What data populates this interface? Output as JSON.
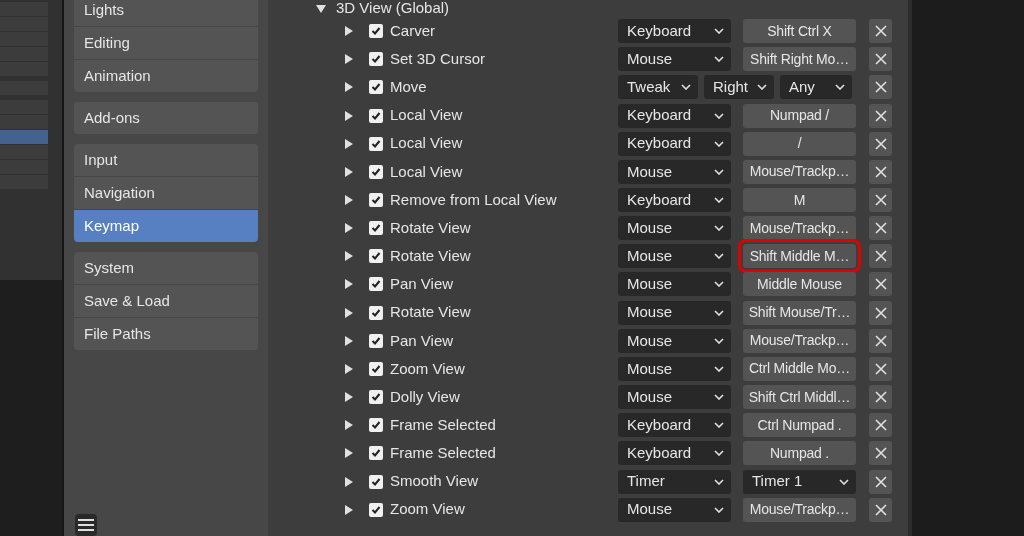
{
  "sidebar": {
    "groups": [
      {
        "items": [
          {
            "label": "Lights",
            "selected": false
          },
          {
            "label": "Editing",
            "selected": false
          },
          {
            "label": "Animation",
            "selected": false
          }
        ]
      },
      {
        "items": [
          {
            "label": "Add-ons",
            "selected": false
          }
        ]
      },
      {
        "items": [
          {
            "label": "Input",
            "selected": false
          },
          {
            "label": "Navigation",
            "selected": false
          },
          {
            "label": "Keymap",
            "selected": true
          }
        ]
      },
      {
        "items": [
          {
            "label": "System",
            "selected": false
          },
          {
            "label": "Save & Load",
            "selected": false
          },
          {
            "label": "File Paths",
            "selected": false
          }
        ]
      }
    ]
  },
  "keymap": {
    "section": {
      "title": "3D View (Global)",
      "expanded": true
    },
    "rows": [
      {
        "name": "Carver",
        "expanded": false,
        "checked": true,
        "inputs": [
          {
            "kind": "dropdown",
            "text": "Keyboard"
          },
          {
            "kind": "key",
            "text": "Shift Ctrl X"
          }
        ]
      },
      {
        "name": "Set 3D Cursor",
        "expanded": false,
        "checked": true,
        "inputs": [
          {
            "kind": "dropdown",
            "text": "Mouse"
          },
          {
            "kind": "key",
            "text": "Shift Right Mo…"
          }
        ]
      },
      {
        "name": "Move",
        "expanded": false,
        "checked": true,
        "inputs": [
          {
            "kind": "small_dropdown",
            "text": "Tweak"
          },
          {
            "kind": "small_dropdown",
            "text": "Right"
          },
          {
            "kind": "small_dropdown",
            "text": "Any"
          }
        ]
      },
      {
        "name": "Local View",
        "expanded": false,
        "checked": true,
        "inputs": [
          {
            "kind": "dropdown",
            "text": "Keyboard"
          },
          {
            "kind": "key",
            "text": "Numpad /"
          }
        ]
      },
      {
        "name": "Local View",
        "expanded": false,
        "checked": true,
        "inputs": [
          {
            "kind": "dropdown",
            "text": "Keyboard"
          },
          {
            "kind": "key",
            "text": "/"
          }
        ]
      },
      {
        "name": "Local View",
        "expanded": false,
        "checked": true,
        "inputs": [
          {
            "kind": "dropdown",
            "text": "Mouse"
          },
          {
            "kind": "key",
            "text": "Mouse/Trackp…"
          }
        ]
      },
      {
        "name": "Remove from Local View",
        "expanded": false,
        "checked": true,
        "inputs": [
          {
            "kind": "dropdown",
            "text": "Keyboard"
          },
          {
            "kind": "key",
            "text": "M"
          }
        ]
      },
      {
        "name": "Rotate View",
        "expanded": false,
        "checked": true,
        "inputs": [
          {
            "kind": "dropdown",
            "text": "Mouse"
          },
          {
            "kind": "key",
            "text": "Mouse/Trackp…"
          }
        ]
      },
      {
        "name": "Rotate View",
        "expanded": false,
        "checked": true,
        "inputs": [
          {
            "kind": "dropdown",
            "text": "Mouse"
          },
          {
            "kind": "key",
            "text": "Shift Middle M…",
            "highlighted": true
          }
        ]
      },
      {
        "name": "Pan View",
        "expanded": false,
        "checked": true,
        "inputs": [
          {
            "kind": "dropdown",
            "text": "Mouse"
          },
          {
            "kind": "key",
            "text": "Middle Mouse"
          }
        ]
      },
      {
        "name": "Rotate View",
        "expanded": false,
        "checked": true,
        "inputs": [
          {
            "kind": "dropdown",
            "text": "Mouse"
          },
          {
            "kind": "key",
            "text": "Shift Mouse/Tr…"
          }
        ]
      },
      {
        "name": "Pan View",
        "expanded": false,
        "checked": true,
        "inputs": [
          {
            "kind": "dropdown",
            "text": "Mouse"
          },
          {
            "kind": "key",
            "text": "Mouse/Trackp…"
          }
        ]
      },
      {
        "name": "Zoom View",
        "expanded": false,
        "checked": true,
        "inputs": [
          {
            "kind": "dropdown",
            "text": "Mouse"
          },
          {
            "kind": "key",
            "text": "Ctrl Middle Mo…"
          }
        ]
      },
      {
        "name": "Dolly View",
        "expanded": false,
        "checked": true,
        "inputs": [
          {
            "kind": "dropdown",
            "text": "Mouse"
          },
          {
            "kind": "key",
            "text": "Shift Ctrl Middl…"
          }
        ]
      },
      {
        "name": "Frame Selected",
        "expanded": false,
        "checked": true,
        "inputs": [
          {
            "kind": "dropdown",
            "text": "Keyboard"
          },
          {
            "kind": "key",
            "text": "Ctrl Numpad ."
          }
        ]
      },
      {
        "name": "Frame Selected",
        "expanded": false,
        "checked": true,
        "inputs": [
          {
            "kind": "dropdown",
            "text": "Keyboard"
          },
          {
            "kind": "key",
            "text": "Numpad ."
          }
        ]
      },
      {
        "name": "Smooth View",
        "expanded": false,
        "checked": true,
        "inputs": [
          {
            "kind": "dropdown",
            "text": "Timer"
          },
          {
            "kind": "dropdown",
            "text": "Timer 1"
          }
        ]
      },
      {
        "name": "Zoom View",
        "expanded": false,
        "checked": true,
        "inputs": [
          {
            "kind": "dropdown",
            "text": "Mouse"
          },
          {
            "kind": "key",
            "text": "Mouse/Trackp…"
          }
        ]
      }
    ]
  }
}
